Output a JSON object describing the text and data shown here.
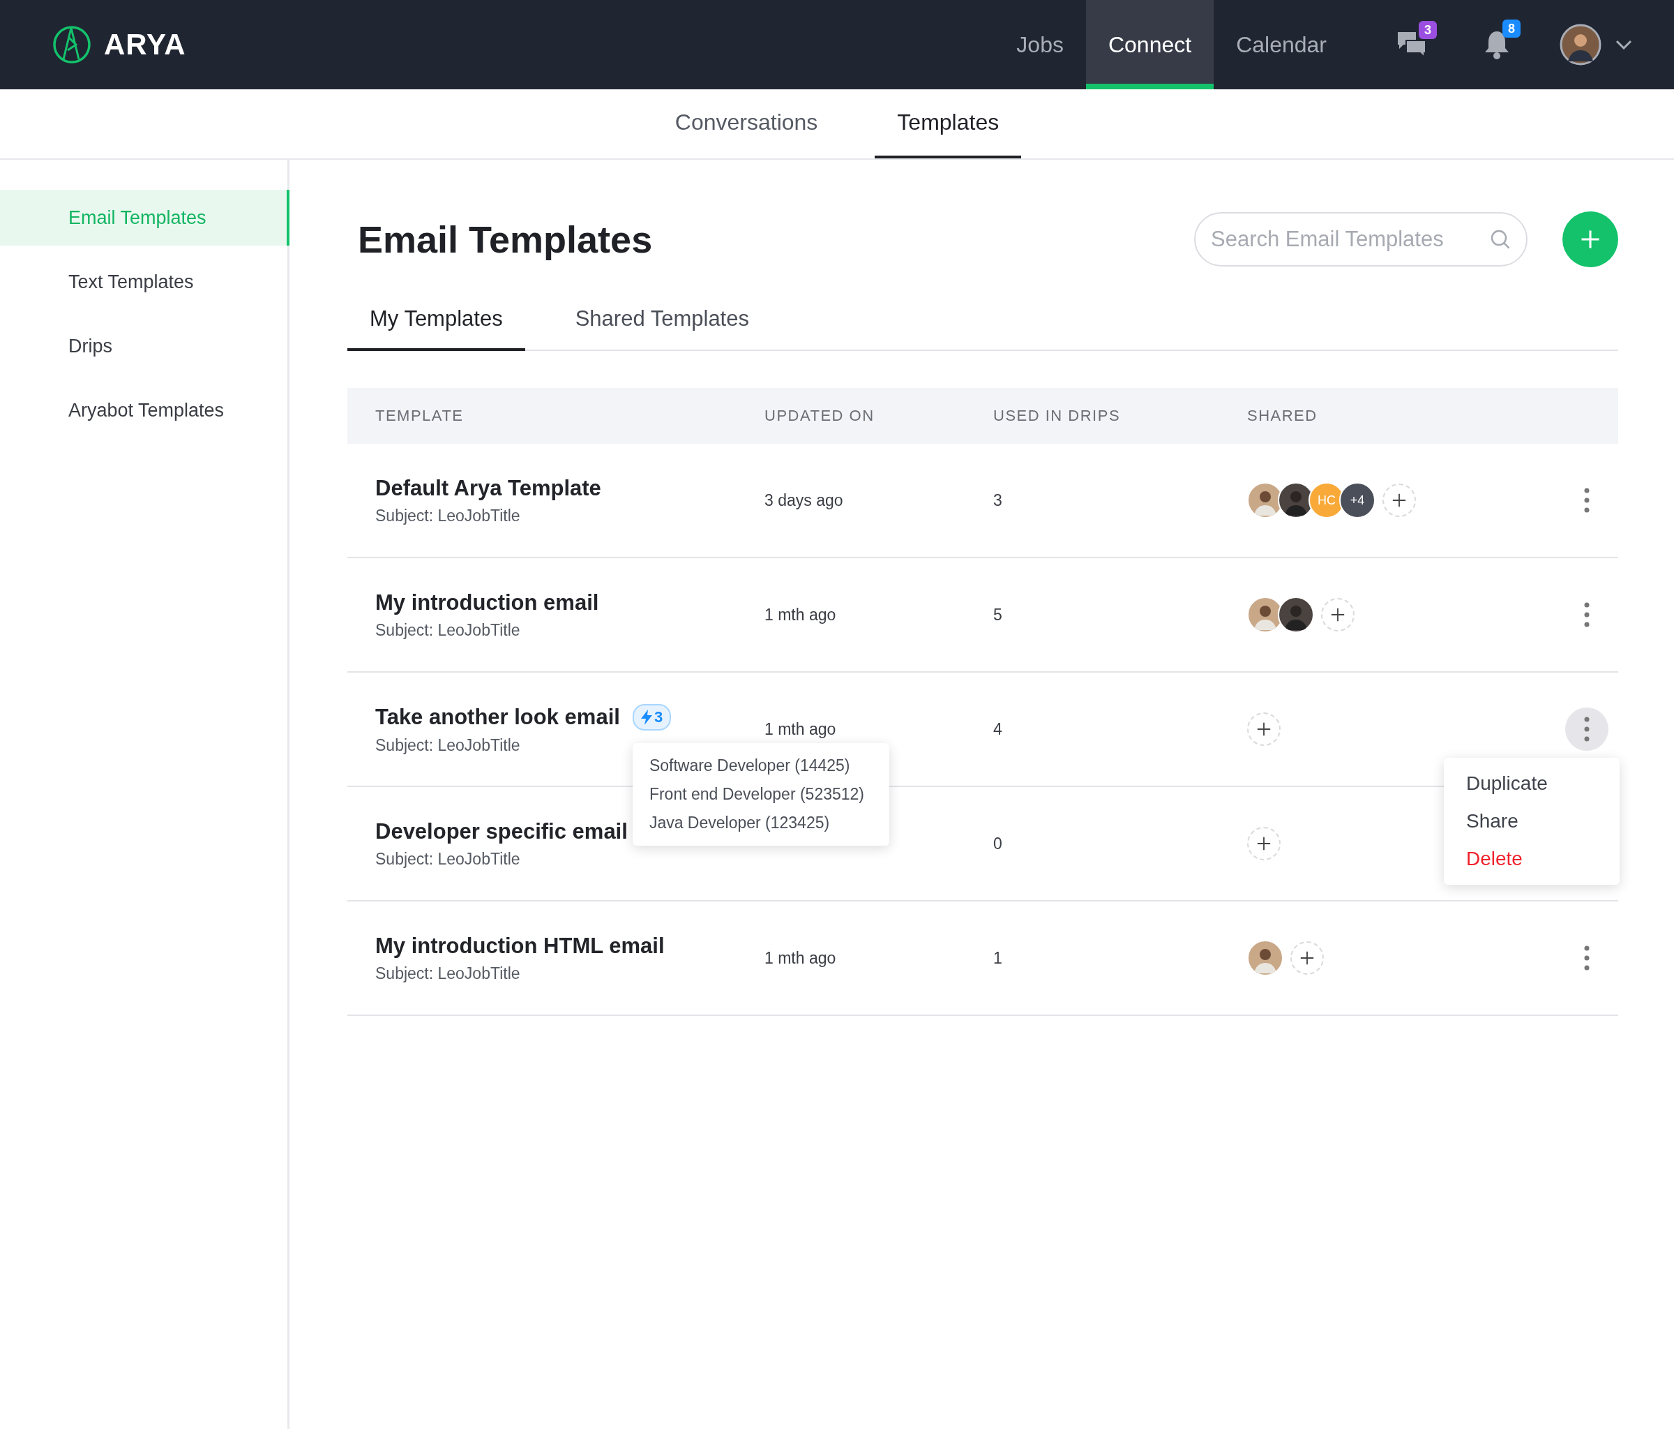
{
  "header": {
    "logo": "ARYA",
    "nav": [
      {
        "label": "Jobs",
        "selected": false
      },
      {
        "label": "Connect",
        "selected": true
      },
      {
        "label": "Calendar",
        "selected": false
      }
    ],
    "chat_badge": "3",
    "notification_badge": "8"
  },
  "subtabs": [
    {
      "label": "Conversations",
      "selected": false
    },
    {
      "label": "Templates",
      "selected": true
    }
  ],
  "sidebar": {
    "items": [
      {
        "label": "Email Templates",
        "selected": true
      },
      {
        "label": "Text Templates",
        "selected": false
      },
      {
        "label": "Drips",
        "selected": false
      },
      {
        "label": "Aryabot Templates",
        "selected": false
      }
    ]
  },
  "page": {
    "title": "Email Templates",
    "search": {
      "placeholder": "Search Email Templates"
    }
  },
  "tabs": [
    {
      "label": "My Templates",
      "selected": true
    },
    {
      "label": "Shared Templates",
      "selected": false
    }
  ],
  "table": {
    "columns": [
      "TEMPLATE",
      "UPDATED ON",
      "USED IN DRIPS",
      "SHARED"
    ],
    "rows": [
      {
        "name": "Default Arya Template",
        "subject": "Subject: LeoJobTitle",
        "updated": "3 days ago",
        "drips": "3",
        "shared": [
          {
            "kind": "photo"
          },
          {
            "kind": "photo"
          },
          {
            "kind": "initials",
            "text": "HC",
            "color": "#f8a937"
          },
          {
            "kind": "count",
            "text": "+4",
            "color": "#4a4f5a"
          }
        ],
        "menu_open": false
      },
      {
        "name": "My introduction email",
        "subject": "Subject: LeoJobTitle",
        "updated": "1 mth ago",
        "drips": "5",
        "shared": [
          {
            "kind": "photo"
          },
          {
            "kind": "photo"
          }
        ],
        "menu_open": false
      },
      {
        "name": "Take another look email",
        "subject": "Subject: LeoJobTitle",
        "updated": "1 mth ago",
        "drips": "4",
        "badge": "3",
        "badge_popup": [
          "Software Developer (14425)",
          "Front end Developer (523512)",
          "Java Developer (123425)"
        ],
        "menu_open": true
      },
      {
        "name": "Developer specific email",
        "subject": "Subject: LeoJobTitle",
        "drips": "0",
        "menu_open": false,
        "actions_hidden": true
      },
      {
        "name": "My introduction HTML email",
        "subject": "Subject: LeoJobTitle",
        "updated": "1 mth ago",
        "drips": "1",
        "shared": [
          {
            "kind": "photo"
          }
        ],
        "menu_open": false
      }
    ]
  },
  "row_menu": [
    {
      "label": "Duplicate",
      "kind": "normal"
    },
    {
      "label": "Share",
      "kind": "normal"
    },
    {
      "label": "Delete",
      "kind": "danger"
    }
  ]
}
